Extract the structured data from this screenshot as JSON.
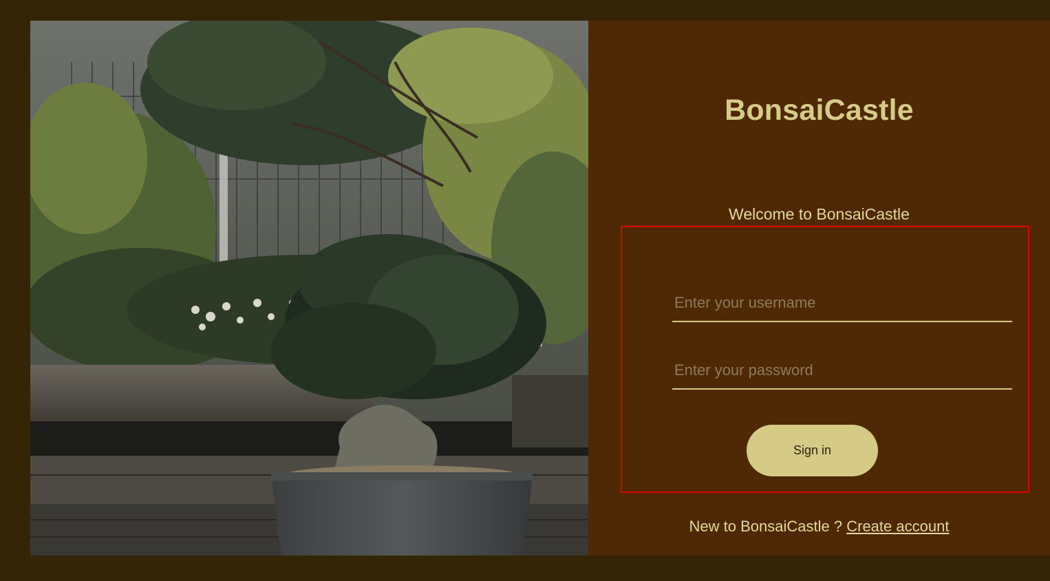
{
  "photo": {
    "description_icon": "bonsai-garden-photo"
  },
  "login": {
    "brand": "BonsaiCastle",
    "welcome": "Welcome to BonsaiCastle",
    "username_placeholder": "Enter your username",
    "username_value": "",
    "password_placeholder": "Enter your password",
    "password_value": "",
    "signin_label": "Sign in",
    "signup_prompt": "New to BonsaiCastle ?",
    "signup_link": "Create account"
  },
  "colors": {
    "page_background": "#332506",
    "panel_background": "#4f2905",
    "accent": "#d6cc86",
    "highlight_border": "#e00000"
  }
}
